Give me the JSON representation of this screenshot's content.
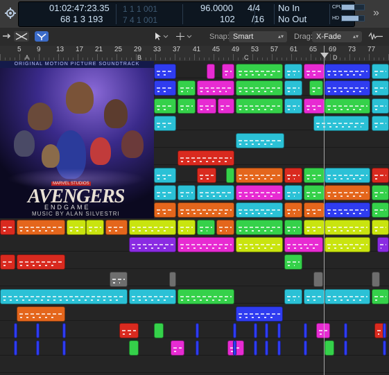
{
  "transport": {
    "time": "01:02:47:23.35",
    "bars": "68   1   3   193",
    "cycle_start": "1   1   1   001",
    "cycle_end": "7   4   1   001",
    "tempo": "96.0000",
    "tempo_sub": "102",
    "signature": "4/4",
    "division": "/16",
    "in_label": "No In",
    "out_label": "No Out",
    "cpu_label": "CPU",
    "hd_label": "HD",
    "cpu_level": 0.55,
    "hd_level": 0.75,
    "expand_icon": "»"
  },
  "toolbar": {
    "snap_label": "Snap:",
    "snap_value": "Smart",
    "drag_label": "Drag:",
    "drag_value": "X-Fade"
  },
  "ruler": {
    "bars": [
      "5",
      "9",
      "13",
      "17",
      "21",
      "25",
      "29",
      "33",
      "37",
      "41",
      "45",
      "49",
      "53",
      "57",
      "61",
      "65",
      "69",
      "73",
      "77"
    ],
    "markers": [
      "A",
      "B",
      "C",
      "D"
    ]
  },
  "album": {
    "banner": "ORIGINAL MOTION PICTURE SOUNDTRACK",
    "studio": "MARVEL STUDIOS",
    "title": "AVENGERS",
    "subtitle": "ENDGAME",
    "credit": "MUSIC BY ALAN SILVESTRI"
  },
  "colors": {
    "blue": "#2f3cf0",
    "magenta": "#e72bd2",
    "green": "#35d14a",
    "lime": "#c9e40f",
    "cyan": "#2bc1d6",
    "red": "#d92a1f",
    "orange": "#e4661c",
    "purple": "#8a2be2",
    "grey": "#6e6e6e"
  }
}
